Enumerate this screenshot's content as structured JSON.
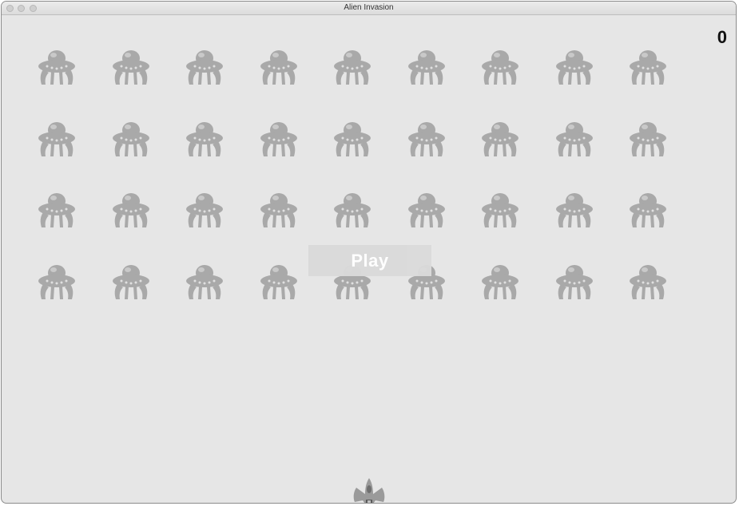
{
  "window": {
    "title": "Alien Invasion"
  },
  "hud": {
    "score": "0"
  },
  "play_button": {
    "label": "Play"
  },
  "fleet": {
    "rows": 4,
    "columns": 9,
    "alien_color": "#a9a9a9"
  },
  "ship": {
    "color": "#8a8a8a"
  },
  "colors": {
    "background": "#e6e6e6",
    "button_bg": "#dadada",
    "button_text": "#ffffff"
  }
}
